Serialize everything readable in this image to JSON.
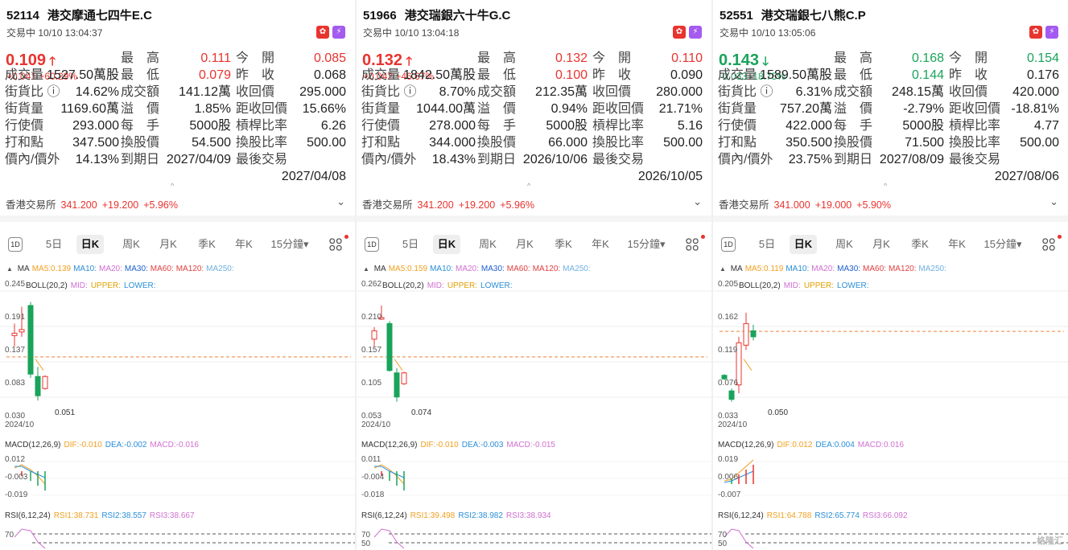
{
  "panels": [
    {
      "code": "52114",
      "name": "港交摩通七四牛E.C",
      "status": "交易中 10/10 13:04:37",
      "price": "0.109",
      "dir": "up",
      "change": "+0.041 +60.29%",
      "stats": [
        [
          [
            "成交量",
            "1527.50萬股"
          ],
          [
            "最　高",
            "0.111",
            "up"
          ],
          [
            "今　開",
            "0.085",
            "up"
          ]
        ],
        [
          [
            "成交量",
            "1527.50萬股"
          ],
          [
            "最　低",
            "0.079",
            "up"
          ],
          [
            "昨　收",
            "0.068"
          ]
        ],
        [
          [
            "街貨比 ⓘ",
            "14.62%"
          ],
          [
            "成交額",
            "141.12萬"
          ],
          [
            "收回價",
            "295.000"
          ]
        ],
        [
          [
            "街貨量",
            "1169.60萬"
          ],
          [
            "溢　價",
            "1.85%"
          ],
          [
            "距收回價",
            "15.66%"
          ]
        ],
        [
          [
            "行使價",
            "293.000"
          ],
          [
            "每　手",
            "5000股"
          ],
          [
            "槓桿比率",
            "6.26"
          ]
        ],
        [
          [
            "打和點",
            "347.500"
          ],
          [
            "換股價",
            "54.500"
          ],
          [
            "換股比率",
            "500.00"
          ]
        ],
        [
          [
            "價內/價外",
            "14.13%"
          ],
          [
            "到期日",
            "2027/04/09"
          ],
          [
            "最後交易",
            "2027/04/08"
          ]
        ]
      ],
      "exchange": {
        "name": "香港交易所",
        "price": "341.200",
        "chg": "+19.200",
        "pct": "+5.96%"
      },
      "ma": {
        "ma5": "MA5:0.139",
        "ma10": "MA10:",
        "ma20": "MA20:",
        "ma30": "MA30:",
        "ma60": "MA60:",
        "ma120": "MA120:",
        "ma250": "MA250:"
      },
      "axis": [
        "0.245",
        "0.191",
        "0.137",
        "0.083",
        "0.030"
      ],
      "low_label": "0.051",
      "date": "2024/10",
      "macd": {
        "title": "MACD(12,26,9)",
        "dif": "DIF:-0.010",
        "dea": "DEA:-0.002",
        "macd": "MACD:-0.016",
        "axis": [
          "0.012",
          "-0.003",
          "-0.019"
        ]
      },
      "rsi": {
        "title": "RSI(6,12,24)",
        "r1": "RSI1:38.731",
        "r2": "RSI2:38.557",
        "r3": "RSI3:38.667",
        "axis": [
          "70"
        ]
      }
    },
    {
      "code": "51966",
      "name": "港交瑞銀六十牛G.C",
      "status": "交易中 10/10 13:04:18",
      "price": "0.132",
      "dir": "up",
      "change": "+0.042 +46.67%",
      "stats": [
        [
          [
            "成交量",
            "1842.50萬股"
          ],
          [
            "最　高",
            "0.132",
            "up"
          ],
          [
            "今　開",
            "0.110",
            "up"
          ]
        ],
        [
          [
            "成交量",
            "1842.50萬股"
          ],
          [
            "最　低",
            "0.100",
            "up"
          ],
          [
            "昨　收",
            "0.090"
          ]
        ],
        [
          [
            "街貨比 ⓘ",
            "8.70%"
          ],
          [
            "成交額",
            "212.35萬"
          ],
          [
            "收回價",
            "280.000"
          ]
        ],
        [
          [
            "街貨量",
            "1044.00萬"
          ],
          [
            "溢　價",
            "0.94%"
          ],
          [
            "距收回價",
            "21.71%"
          ]
        ],
        [
          [
            "行使價",
            "278.000"
          ],
          [
            "每　手",
            "5000股"
          ],
          [
            "槓桿比率",
            "5.16"
          ]
        ],
        [
          [
            "打和點",
            "344.000"
          ],
          [
            "換股價",
            "66.000"
          ],
          [
            "換股比率",
            "500.00"
          ]
        ],
        [
          [
            "價內/價外",
            "18.43%"
          ],
          [
            "到期日",
            "2026/10/06"
          ],
          [
            "最後交易",
            "2026/10/05"
          ]
        ]
      ],
      "exchange": {
        "name": "香港交易所",
        "price": "341.200",
        "chg": "+19.200",
        "pct": "+5.96%"
      },
      "ma": {
        "ma5": "MA5:0.159",
        "ma10": "MA10:",
        "ma20": "MA20:",
        "ma30": "MA30:",
        "ma60": "MA60:",
        "ma120": "MA120:",
        "ma250": "MA250:"
      },
      "axis": [
        "0.262",
        "0.210",
        "0.157",
        "0.105",
        "0.053"
      ],
      "low_label": "0.074",
      "date": "2024/10",
      "macd": {
        "title": "MACD(12,26,9)",
        "dif": "DIF:-0.010",
        "dea": "DEA:-0.003",
        "macd": "MACD:-0.015",
        "axis": [
          "0.011",
          "-0.004",
          "-0.018"
        ]
      },
      "rsi": {
        "title": "RSI(6,12,24)",
        "r1": "RSI1:39.498",
        "r2": "RSI2:38.982",
        "r3": "RSI3:38.934",
        "axis": [
          "70",
          "50"
        ]
      }
    },
    {
      "code": "52551",
      "name": "港交瑞銀七八熊C.P",
      "status": "交易中 10/10 13:05:06",
      "price": "0.143",
      "dir": "dn",
      "change": "-0.033 -18.75%",
      "stats": [
        [
          [
            "成交量",
            "1589.50萬股"
          ],
          [
            "最　高",
            "0.168",
            "dn"
          ],
          [
            "今　開",
            "0.154",
            "dn"
          ]
        ],
        [
          [
            "成交量",
            "1589.50萬股"
          ],
          [
            "最　低",
            "0.144",
            "dn"
          ],
          [
            "昨　收",
            "0.176"
          ]
        ],
        [
          [
            "街貨比 ⓘ",
            "6.31%"
          ],
          [
            "成交額",
            "248.15萬"
          ],
          [
            "收回價",
            "420.000"
          ]
        ],
        [
          [
            "街貨量",
            "757.20萬"
          ],
          [
            "溢　價",
            "-2.79%"
          ],
          [
            "距收回價",
            "-18.81%"
          ]
        ],
        [
          [
            "行使價",
            "422.000"
          ],
          [
            "每　手",
            "5000股"
          ],
          [
            "槓桿比率",
            "4.77"
          ]
        ],
        [
          [
            "打和點",
            "350.500"
          ],
          [
            "換股價",
            "71.500"
          ],
          [
            "換股比率",
            "500.00"
          ]
        ],
        [
          [
            "價內/價外",
            "23.75%"
          ],
          [
            "到期日",
            "2027/08/09"
          ],
          [
            "最後交易",
            "2027/08/06"
          ]
        ]
      ],
      "exchange": {
        "name": "香港交易所",
        "price": "341.000",
        "chg": "+19.000",
        "pct": "+5.90%"
      },
      "ma": {
        "ma5": "MA5:0.119",
        "ma10": "MA10:",
        "ma20": "MA20:",
        "ma30": "MA30:",
        "ma60": "MA60:",
        "ma120": "MA120:",
        "ma250": "MA250:"
      },
      "axis": [
        "0.205",
        "0.162",
        "0.119",
        "0.076",
        "0.033"
      ],
      "low_label": "0.050",
      "date": "2024/10",
      "macd": {
        "title": "MACD(12,26,9)",
        "dif": "DIF:0.012",
        "dea": "DEA:0.004",
        "macd": "MACD:0.016",
        "axis": [
          "0.019",
          "0.006",
          "-0.007"
        ]
      },
      "rsi": {
        "title": "RSI(6,12,24)",
        "r1": "RSI1:64.788",
        "r2": "RSI2:65.774",
        "r3": "RSI3:66.092",
        "axis": [
          "70",
          "50"
        ]
      }
    }
  ],
  "tabs": [
    "1D",
    "5日",
    "日K",
    "周K",
    "月K",
    "季K",
    "年K",
    "15分鐘▾"
  ],
  "boll": {
    "title": "BOLL(20,2)",
    "mid": "MID:",
    "upper": "UPPER:",
    "lower": "LOWER:"
  },
  "ma_label": "MA",
  "flags": {
    "hk": "✿",
    "sw": "⚡"
  },
  "caret": "^",
  "chev": "⌄",
  "watermark": "格隆汇",
  "colors": {
    "up": "#e8342f",
    "down": "#1aa35a",
    "ma5": "#f0a020",
    "ma10": "#2a8fd8",
    "ma20": "#d070d0",
    "ma30": "#2060d0",
    "ma60": "#e04040",
    "ma120": "#e04040",
    "ma250": "#70b0e0"
  }
}
